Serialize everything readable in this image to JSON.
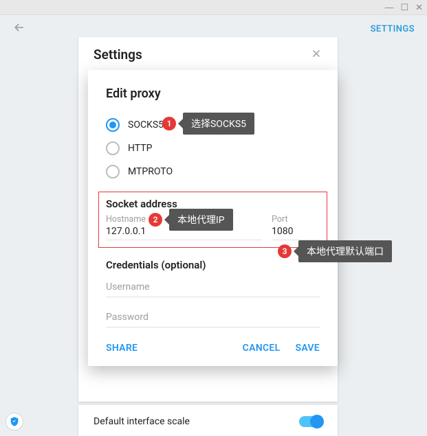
{
  "window_controls": {
    "min": "—",
    "max": "☐",
    "close": "✕"
  },
  "header": {
    "settings_link": "SETTINGS"
  },
  "under_panel": {
    "title": "Settings"
  },
  "bottom": {
    "label": "Default interface scale"
  },
  "modal": {
    "title": "Edit proxy",
    "radios": [
      {
        "label": "SOCKS5",
        "checked": true
      },
      {
        "label": "HTTP",
        "checked": false
      },
      {
        "label": "MTPROTO",
        "checked": false
      }
    ],
    "socket_title": "Socket address",
    "hostname_label": "Hostname",
    "hostname_value": "127.0.0.1",
    "port_label": "Port",
    "port_value": "1080",
    "credentials_title": "Credentials (optional)",
    "username_placeholder": "Username",
    "password_placeholder": "Password",
    "share": "SHARE",
    "cancel": "CANCEL",
    "save": "SAVE"
  },
  "annotations": {
    "a1": {
      "num": "1",
      "tip": "选择SOCKS5"
    },
    "a2": {
      "num": "2",
      "tip": "本地代理IP"
    },
    "a3": {
      "num": "3",
      "tip": "本地代理默认端口"
    }
  }
}
